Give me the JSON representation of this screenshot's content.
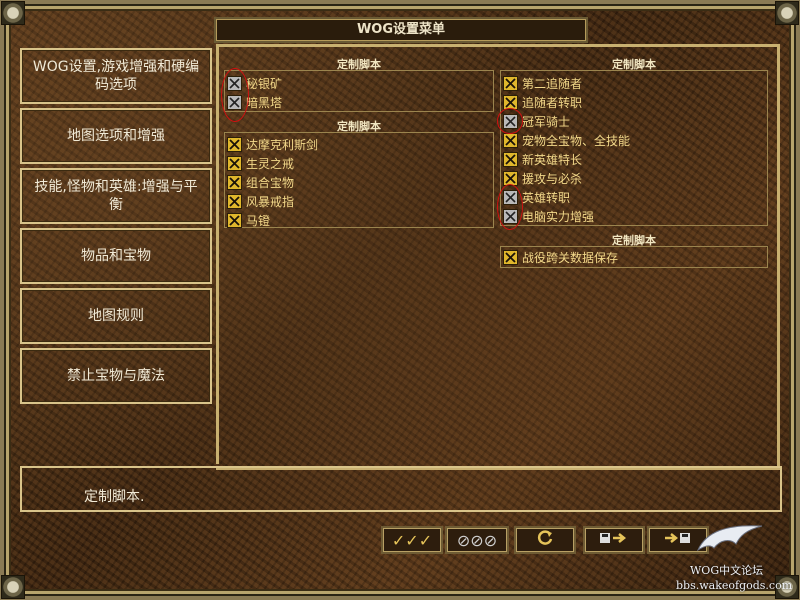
{
  "window": {
    "title": "WOG设置菜单"
  },
  "sidebar": {
    "items": [
      {
        "label": "WOG设置,游戏增强和硬编码选项"
      },
      {
        "label": "地图选项和增强"
      },
      {
        "label": "技能,怪物和英雄:增强与平衡"
      },
      {
        "label": "物品和宝物"
      },
      {
        "label": "地图规则"
      },
      {
        "label": "禁止宝物与魔法"
      }
    ],
    "active_tab": {
      "label": "定制脚本."
    }
  },
  "groups": {
    "left_top": {
      "title": "定制脚本",
      "items": [
        {
          "label": "秘银矿",
          "checked": false
        },
        {
          "label": "暗黑塔",
          "checked": false
        }
      ]
    },
    "left_bottom": {
      "title": "定制脚本",
      "items": [
        {
          "label": "达摩克利斯剑",
          "checked": true
        },
        {
          "label": "生灵之戒",
          "checked": true
        },
        {
          "label": "组合宝物",
          "checked": true
        },
        {
          "label": "风暴戒指",
          "checked": true
        },
        {
          "label": "马镫",
          "checked": true
        }
      ]
    },
    "right_top": {
      "title": "定制脚本",
      "items": [
        {
          "label": "第二追随者",
          "checked": true
        },
        {
          "label": "追随者转职",
          "checked": true
        },
        {
          "label": "冠军骑士",
          "checked": false
        },
        {
          "label": "宠物全宝物、全技能",
          "checked": true
        },
        {
          "label": "新英雄特长",
          "checked": true
        },
        {
          "label": "援攻与必杀",
          "checked": true
        },
        {
          "label": "英雄转职",
          "checked": false
        },
        {
          "label": "电脑实力增强",
          "checked": false
        }
      ]
    },
    "right_bottom": {
      "title": "定制脚本",
      "items": [
        {
          "label": "战役跨关数据保存",
          "checked": true
        }
      ]
    }
  },
  "bottom_bar": {
    "check_all": "✓✓✓",
    "uncheck_all": "⊘⊘⊘",
    "reset_icon": "refresh-icon",
    "save_icon": "save-disk-arrow-icon",
    "load_icon": "load-arrow-disk-icon"
  },
  "watermark": {
    "line1": "WOG中文论坛",
    "line2": "bbs.wakeofgods.com"
  },
  "colors": {
    "checked": "#e0b72c",
    "unchecked": "#b9b9b9",
    "label": "#f3d98a",
    "annotation_circle": "#d01010"
  }
}
